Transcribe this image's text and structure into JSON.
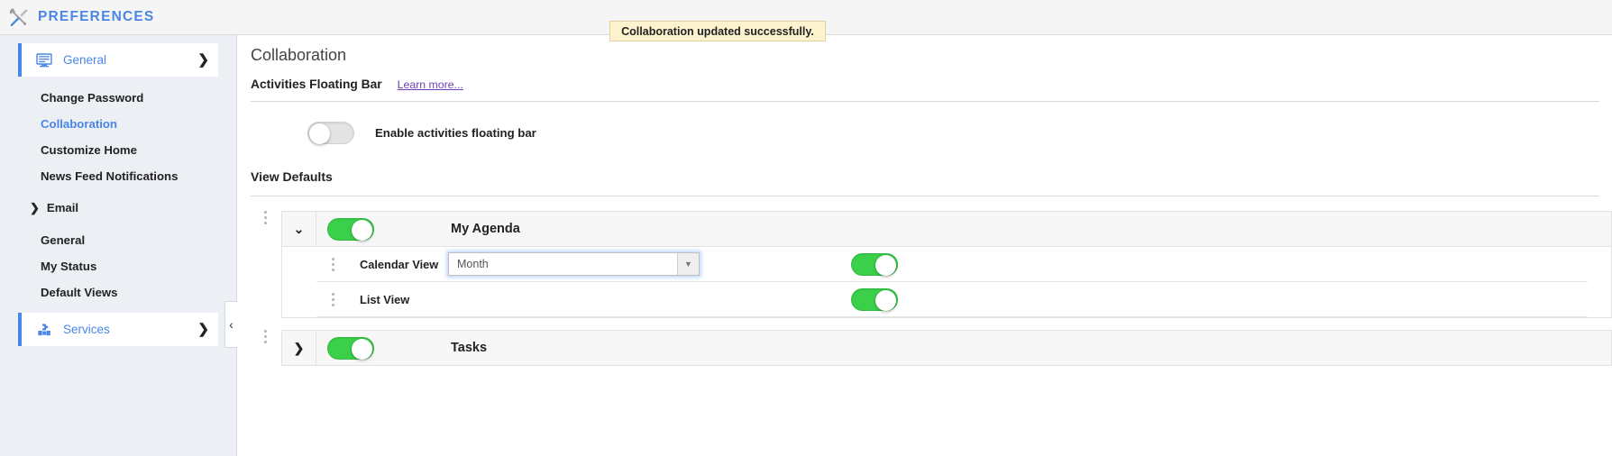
{
  "header": {
    "title": "PREFERENCES",
    "icon": "tools-icon"
  },
  "toast": {
    "message": "Collaboration updated successfully."
  },
  "sidebar": {
    "sections": [
      {
        "label": "General",
        "icon": "monitor-icon",
        "chevron": "❯",
        "items": [
          {
            "label": "Change Password",
            "active": false
          },
          {
            "label": "Collaboration",
            "active": true
          },
          {
            "label": "Customize Home",
            "active": false
          },
          {
            "label": "News Feed Notifications",
            "active": false
          }
        ],
        "group": {
          "label": "Email",
          "chevron": "❯",
          "items": [
            {
              "label": "General"
            },
            {
              "label": "My Status"
            },
            {
              "label": "Default Views"
            }
          ]
        }
      },
      {
        "label": "Services",
        "icon": "puzzle-icon",
        "chevron": "❯"
      }
    ],
    "collapse_handle": "‹"
  },
  "main": {
    "page_title": "Collaboration",
    "floating_bar": {
      "title": "Activities Floating Bar",
      "learn_more": "Learn more...",
      "toggle_label": "Enable activities floating bar",
      "toggle_state": "off"
    },
    "view_defaults": {
      "title": "View Defaults",
      "groups": [
        {
          "name": "My Agenda",
          "expander": "⌄",
          "expanded": true,
          "toggle_state": "on",
          "rows": [
            {
              "label": "Calendar View",
              "control": "select",
              "value": "Month",
              "arrow": "▼",
              "toggle_state": "on"
            },
            {
              "label": "List View",
              "control": "none",
              "toggle_state": "on"
            }
          ]
        },
        {
          "name": "Tasks",
          "expander": "❯",
          "expanded": false,
          "toggle_state": "on",
          "rows": []
        }
      ]
    }
  },
  "colors": {
    "accent_blue": "#4a86e8",
    "toggle_on_green": "#3ad04a",
    "toast_bg": "#fdf3cf",
    "link_purple": "#6c3fb5"
  }
}
